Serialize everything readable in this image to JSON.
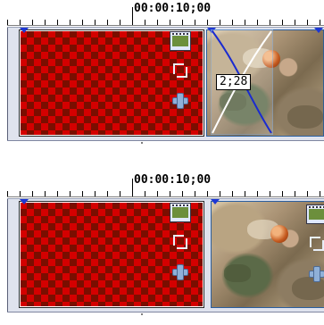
{
  "panels": [
    {
      "timecode": "00:00:10;00",
      "transition_duration": "2;28",
      "clip_a_icons": [
        "film-icon",
        "crop-icon",
        "motion-icon"
      ],
      "has_transition": true
    },
    {
      "timecode": "00:00:10;00",
      "clip_a_icons": [
        "film-icon",
        "crop-icon",
        "motion-icon"
      ],
      "has_transition": false
    }
  ],
  "colors": {
    "checker_red": "#d40000",
    "checker_dark": "#7a0e00",
    "track_bg": "#dfe3ee",
    "selection_marker": "#1d37d4"
  }
}
